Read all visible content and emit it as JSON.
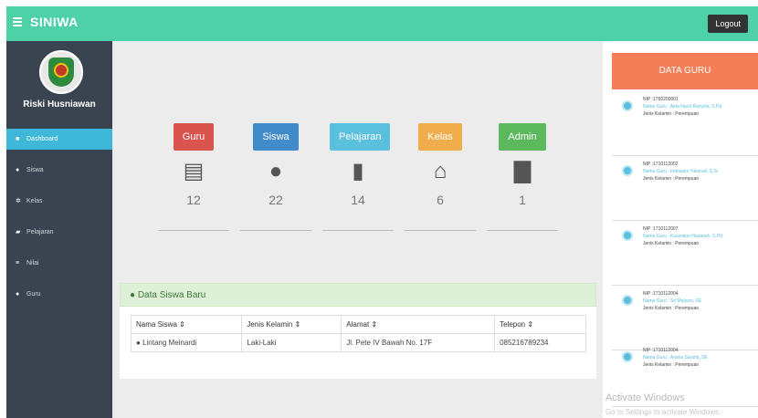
{
  "app": {
    "brand": "SINIWA",
    "logout_label": "Logout"
  },
  "sidebar": {
    "username": "Riski Husniawan",
    "items": [
      {
        "label": "Dashboard",
        "icon": "dashboard-icon",
        "active": true
      },
      {
        "label": "Siswa",
        "icon": "user-icon",
        "active": false
      },
      {
        "label": "Kelas",
        "icon": "gears-icon",
        "active": false
      },
      {
        "label": "Pelajaran",
        "icon": "book-icon",
        "active": false
      },
      {
        "label": "Nilai",
        "icon": "list-icon",
        "active": false
      },
      {
        "label": "Guru",
        "icon": "user-icon",
        "active": false
      }
    ]
  },
  "stats": [
    {
      "label": "Guru",
      "value": "12",
      "icon": "list-icon",
      "color": "#d9534f"
    },
    {
      "label": "Siswa",
      "value": "22",
      "icon": "user-icon",
      "color": "#428bca"
    },
    {
      "label": "Pelajaran",
      "value": "14",
      "icon": "book-icon",
      "color": "#5bc0de"
    },
    {
      "label": "Kelas",
      "value": "6",
      "icon": "home-icon",
      "color": "#f0ad4e"
    },
    {
      "label": "Admin",
      "value": "1",
      "icon": "lock-icon",
      "color": "#5cb85c"
    }
  ],
  "panel": {
    "title": "Data Siswa Baru",
    "columns": [
      "Nama Siswa ⇕",
      "Jenis Kelamin ⇕",
      "Alamat ⇕",
      "Telepon ⇕"
    ],
    "rows": [
      [
        "Lintang Meinardi",
        "Laki-Laki",
        "Jl. Pete IV Bawah No. 17F",
        "085216789234"
      ]
    ]
  },
  "guru_panel": {
    "title": "DATA GURU",
    "items": [
      {
        "nip": "NIP :1750200001",
        "nama": "Nama Guru : Aida Nurul Rosyida, S.Pd",
        "jk": "Jenis Kelamin : Perempuan"
      },
      {
        "nip": "NIP :1710112002",
        "nama": "Nama Guru : Indriasini Yulianali, S.Si",
        "jk": "Jenis Kelamin : Perempuan"
      },
      {
        "nip": "NIP :1710112007",
        "nama": "Nama Guru : Kuswatun Hasanah, S.Pd",
        "jk": "Jenis Kelamin : Perempuan"
      },
      {
        "nip": "NIP :1710112004",
        "nama": "Nama Guru : Sri Mulyani, SE",
        "jk": "Jenis Kelamin : Perempuan"
      },
      {
        "nip": "NIP :1710112004",
        "nama": "Nama Guru : Ariana Saranti, SE",
        "jk": "Jenis Kelamin : Perempuan"
      }
    ]
  },
  "watermark": {
    "line1": "Activate Windows",
    "line2": "Go to Settings to activate Windows."
  }
}
